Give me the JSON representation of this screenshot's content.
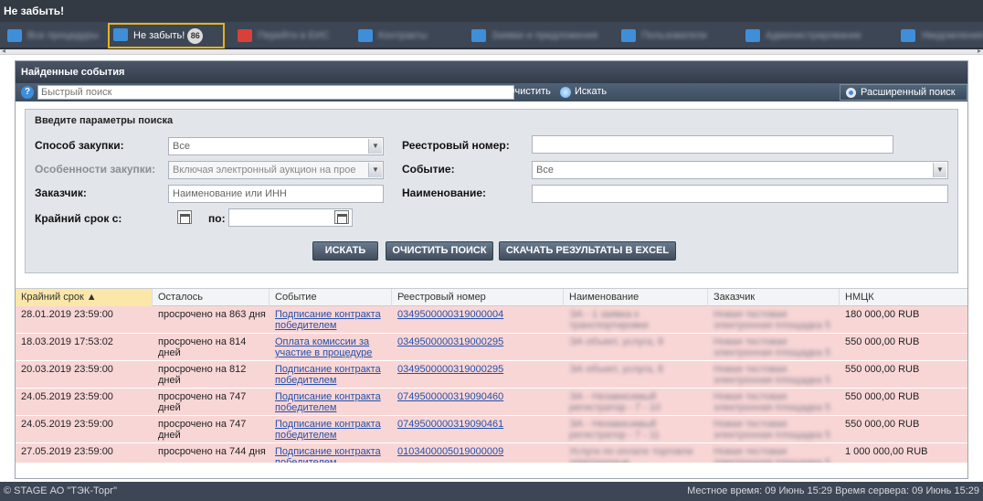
{
  "window": {
    "title": "Не забыть!"
  },
  "tabs": [
    {
      "label": "Все процедуры",
      "blurred": true
    },
    {
      "label": "Не забыть!",
      "badge": "86",
      "active": true
    },
    {
      "label": "Перейти в ЕИС",
      "blurred": true
    },
    {
      "label": "Контракты",
      "blurred": true
    },
    {
      "label": "Заявки и предложения",
      "blurred": true
    },
    {
      "label": "Пользователи",
      "blurred": true
    },
    {
      "label": "Администрирование",
      "blurred": true
    },
    {
      "label": "Уведомления",
      "blurred": true
    }
  ],
  "panel": {
    "title": "Найденные события"
  },
  "search": {
    "placeholder": "Быстрый поиск",
    "clear_label": "Очистить",
    "search_label": "Искать",
    "advanced_label": "Расширенный поиск"
  },
  "filters": {
    "title": "Введите параметры поиска",
    "method_label": "Способ закупки:",
    "method_value": "Все",
    "features_label": "Особенности закупки:",
    "features_value": "Включая электронный аукцион на прое",
    "customer_label": "Заказчик:",
    "customer_placeholder": "Наименование или ИНН",
    "deadline_from_label": "Крайний срок с:",
    "deadline_to_label": "по:",
    "registry_label": "Реестровый номер:",
    "event_label": "Событие:",
    "event_value": "Все",
    "name_label": "Наименование:",
    "btn_search": "ИСКАТЬ",
    "btn_clear": "ОЧИСТИТЬ ПОИСК",
    "btn_excel": "СКАЧАТЬ РЕЗУЛЬТАТЫ В EXCEL"
  },
  "table": {
    "headers": [
      "Крайний срок ▲",
      "Осталось",
      "Событие",
      "Реестровый номер",
      "Наименование",
      "Заказчик",
      "НМЦК"
    ],
    "rows": [
      {
        "deadline": "28.01.2019 23:59:00",
        "remaining": "просрочено на 863 дня",
        "event": "Подписание контракта победителем",
        "registry": "0349500000319000004",
        "name": "ЭА - 1 заявка к транспортировке",
        "customer": "Новая тестовая электронная площадка 5",
        "price": "180 000,00 RUB"
      },
      {
        "deadline": "18.03.2019 17:53:02",
        "remaining": "просрочено на 814 дней",
        "event": "Оплата комиссии за участие в процедуре",
        "registry": "0349500000319000295",
        "name": "ЭА объект, услуга, 8",
        "customer": "Новая тестовая электронная площадка 5",
        "price": "550 000,00 RUB"
      },
      {
        "deadline": "20.03.2019 23:59:00",
        "remaining": "просрочено на 812 дней",
        "event": "Подписание контракта победителем",
        "registry": "0349500000319000295",
        "name": "ЭА объект, услуга, 8",
        "customer": "Новая тестовая электронная площадка 5",
        "price": "550 000,00 RUB"
      },
      {
        "deadline": "24.05.2019 23:59:00",
        "remaining": "просрочено на 747 дней",
        "event": "Подписание контракта победителем",
        "registry": "0749500000319090460",
        "name": "ЭА - Независимый регистратор - 7 - 10",
        "customer": "Новая тестовая электронная площадка 5",
        "price": "550 000,00 RUB"
      },
      {
        "deadline": "24.05.2019 23:59:00",
        "remaining": "просрочено на 747 дней",
        "event": "Подписание контракта победителем",
        "registry": "0749500000319090461",
        "name": "ЭА - Независимый регистратор - 7 - 11",
        "customer": "Новая тестовая электронная площадка 5",
        "price": "550 000,00 RUB"
      },
      {
        "deadline": "27.05.2019 23:59:00",
        "remaining": "просрочено на 744 дня",
        "event": "Подписание контракта победителем",
        "registry": "0103400005019000009",
        "name": "Услуги по оплате торговли электронные",
        "customer": "Новая тестовая электронная площадка 5",
        "price": "1 000 000,00 RUB"
      }
    ]
  },
  "status": {
    "left": "© STAGE АО \"ТЭК-Торг\"",
    "right": "Местное время: 09 Июнь 15:29 Время сервера: 09 Июнь 15:29"
  }
}
